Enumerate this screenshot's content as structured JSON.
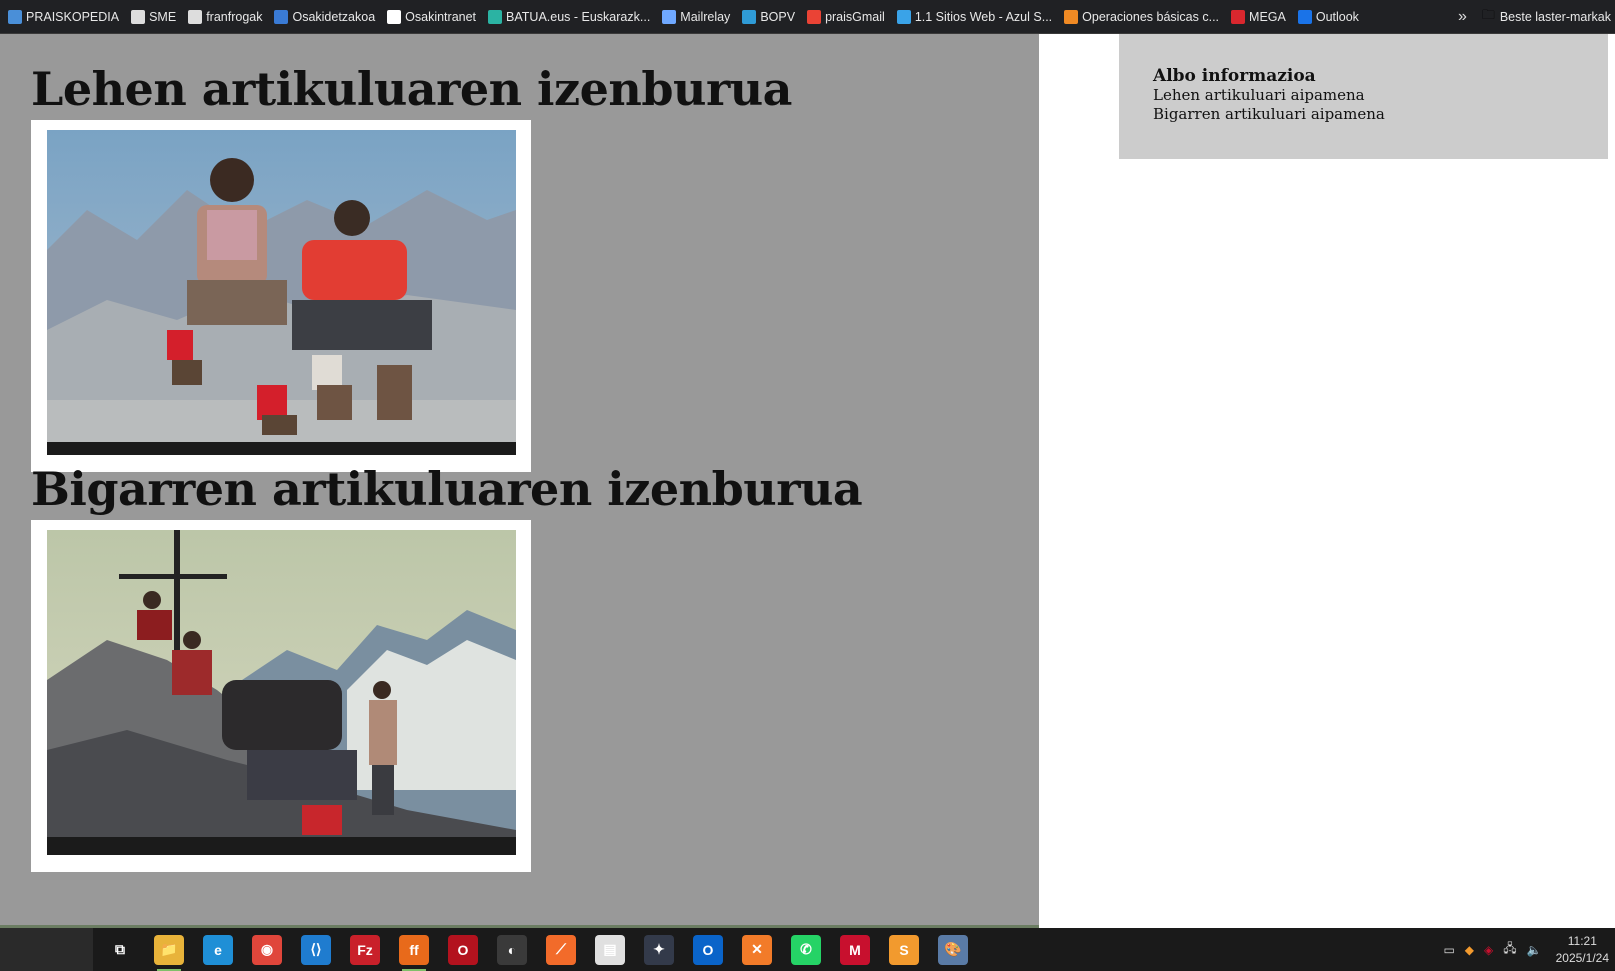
{
  "bookmarks": [
    {
      "label": "PRAISKOPEDIA",
      "icon": "map-icon",
      "color": "#4a8fd8"
    },
    {
      "label": "SME",
      "icon": "building-icon",
      "color": "#dddddd"
    },
    {
      "label": "franfrogak",
      "icon": "wordpress-icon",
      "color": "#dddddd"
    },
    {
      "label": "Osakidetzakoa",
      "icon": "sap-icon",
      "color": "#3a7bd5"
    },
    {
      "label": "Osakintranet",
      "icon": "k-icon",
      "color": "#ffffff"
    },
    {
      "label": "BATUA.eus - Euskarazk...",
      "icon": "batua-icon",
      "color": "#2bb3a3"
    },
    {
      "label": "Mailrelay",
      "icon": "mail-image-icon",
      "color": "#6fa8ff"
    },
    {
      "label": "BOPV",
      "icon": "bopv-icon",
      "color": "#2f9bd6"
    },
    {
      "label": "praisGmail",
      "icon": "gmail-icon",
      "color": "#ea4335"
    },
    {
      "label": "1.1 Sitios Web - Azul S...",
      "icon": "grid-icon",
      "color": "#3aa3e8"
    },
    {
      "label": "Operaciones básicas c...",
      "icon": "triangle-icon",
      "color": "#f08a24"
    },
    {
      "label": "MEGA",
      "icon": "mega-icon",
      "color": "#d9272e"
    },
    {
      "label": "Outlook",
      "icon": "outlook-icon",
      "color": "#1a73e8"
    }
  ],
  "other_bookmarks": "Beste laster-markak",
  "articles": [
    {
      "title": "Lehen artikuluaren izenburua",
      "photo": "Two men sitting on mountain rocks"
    },
    {
      "title": "Bigarren artikuluaren izenburua",
      "photo": "Group of climbers at summit cross"
    }
  ],
  "aside": {
    "title": "Albo informazioa",
    "items": [
      "Lehen artikuluari aipamena",
      "Bigarren artikuluari aipamena"
    ]
  },
  "taskbar": {
    "apps": [
      {
        "name": "task-view-icon",
        "label": "⧉",
        "bg": "transparent",
        "active": false
      },
      {
        "name": "file-explorer-icon",
        "label": "📁",
        "bg": "#e8b33a",
        "active": true
      },
      {
        "name": "edge-icon",
        "label": "e",
        "bg": "#1f8fd6",
        "active": false
      },
      {
        "name": "chrome-icon",
        "label": "◉",
        "bg": "#e0463b",
        "active": false
      },
      {
        "name": "vscode-icon",
        "label": "⟨⟩",
        "bg": "#1f7ccf",
        "active": false
      },
      {
        "name": "filezilla-icon",
        "label": "Fz",
        "bg": "#c9202a",
        "active": false
      },
      {
        "name": "firefox-icon",
        "label": "ff",
        "bg": "#e86a1b",
        "active": true
      },
      {
        "name": "opera-icon",
        "label": "O",
        "bg": "#b3121e",
        "active": false
      },
      {
        "name": "obs-icon",
        "label": "◐",
        "bg": "#3a3a3a",
        "active": false
      },
      {
        "name": "brave-icon",
        "label": "⟋",
        "bg": "#f26b2a",
        "active": false
      },
      {
        "name": "notepad-icon",
        "label": "▤",
        "bg": "#e0e0e0",
        "active": false
      },
      {
        "name": "davinci-icon",
        "label": "✦",
        "bg": "#333a4a",
        "active": false
      },
      {
        "name": "outlook-icon",
        "label": "O",
        "bg": "#0a64c9",
        "active": false
      },
      {
        "name": "xampp-icon",
        "label": "✕",
        "bg": "#f27b29",
        "active": false
      },
      {
        "name": "whatsapp-icon",
        "label": "✆",
        "bg": "#25d366",
        "active": false
      },
      {
        "name": "mcafee-icon",
        "label": "M",
        "bg": "#c8102e",
        "active": false
      },
      {
        "name": "sublime-icon",
        "label": "S",
        "bg": "#f29a2e",
        "active": false
      },
      {
        "name": "paint-icon",
        "label": "🎨",
        "bg": "#5a7ba6",
        "active": false
      }
    ],
    "time": "11:21",
    "date": "2025/1/24"
  }
}
